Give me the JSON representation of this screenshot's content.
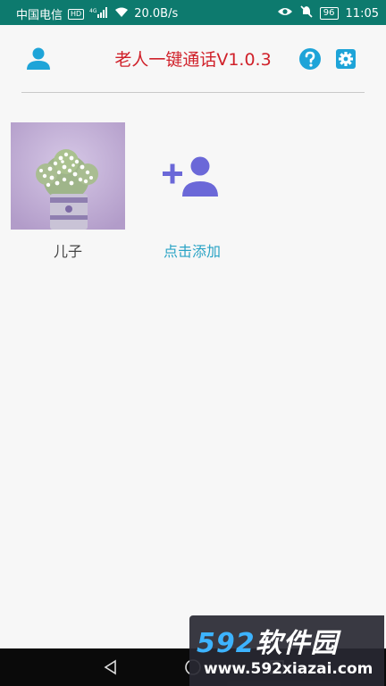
{
  "status_bar": {
    "carrier": "中国电信",
    "hd": "HD",
    "network": "4G",
    "speed": "20.0B/s",
    "battery": "96",
    "time": "11:05",
    "icons": [
      "signal-icon",
      "wifi-icon",
      "eye-icon",
      "mute-icon",
      "battery-icon"
    ]
  },
  "header": {
    "title": "老人一键通话V1.0.3",
    "title_color": "#d0212a",
    "icon_color": "#1ea4d8",
    "icons": {
      "left": "person-icon",
      "help": "help-icon",
      "settings": "gear-icon"
    }
  },
  "contacts": [
    {
      "name": "儿子",
      "photo": "flower-vase-photo"
    }
  ],
  "add_contact": {
    "label": "点击添加",
    "icon": "add-person-icon",
    "icon_color": "#6b68d8",
    "label_color": "#2aa3c5"
  },
  "nav_bar": {
    "buttons": [
      "back-icon",
      "home-icon",
      "recent-apps-icon"
    ]
  },
  "watermark": {
    "brand_number": "592",
    "brand_text": "软件园",
    "url": "www.592xiazai.com"
  }
}
